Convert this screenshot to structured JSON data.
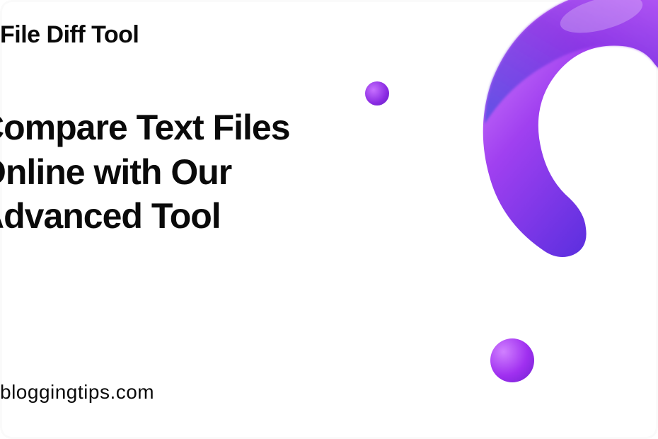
{
  "category": "File Diff Tool",
  "headline": "Compare Text Files Online with Our Advanced Tool",
  "site_url": "bloggingtips.com",
  "colors": {
    "text": "#0a0a0a",
    "gradient_start": "#d080ff",
    "gradient_mid": "#8a2be2",
    "gradient_end": "#2060ff"
  }
}
